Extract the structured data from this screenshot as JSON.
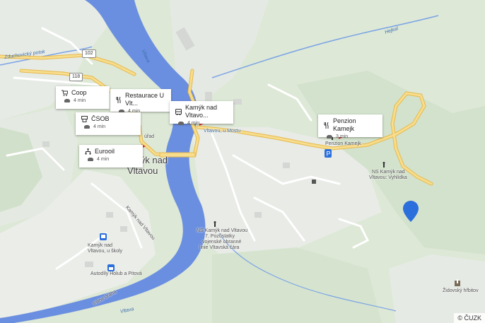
{
  "map": {
    "town_name_line1": "Kamýk nad",
    "town_name_line2": "Vltavou",
    "road_numbers": [
      "102",
      "118"
    ],
    "water_labels": {
      "stream": "Zduchovický potok",
      "river_north": "Vltava",
      "river_south": "Vltava",
      "hejkal": "Hejkal"
    },
    "street_labels": {
      "kamyk_street": "Kamýk nad Vltavou",
      "kamyk_skoly": "Kamýk nad Vltavou, u školy",
      "kamyk_skoly_line1": "Kamýk nad",
      "kamyk_skoly_line2": "Vltavou, u školy",
      "autodily_line1": "Autodíly Holub a Pitová",
      "inline_draha": "Inline dráha",
      "vltavou_u_mostu": "Vltavou, u Mostu",
      "ns_kamyk_line1": "NS Kamýk nad Vltavou",
      "ns_kamyk_line2": "7. Pozůstatky",
      "ns_kamyk_line3": "vojenské obranné",
      "ns_kamyk_line4": "linie Vltavská čára",
      "ns_vyhlidka_line1": "NS Kamýk nad",
      "ns_vyhlidka_line2": "Vltavou: Vyhlídka",
      "penzion_small": "Penzion Kamejk",
      "zidovsky": "Židovský hřbitov",
      "urad": "úřad"
    },
    "copyright": "© ČUZK"
  },
  "poi_cards": [
    {
      "name": "Coop",
      "icon": "cart-icon",
      "time": "4 min"
    },
    {
      "name": "Restaurace U Vlt...",
      "icon": "restaurant-icon",
      "time": "4 min"
    },
    {
      "name": "ČSOB",
      "icon": "atm-icon",
      "time": "4 min"
    },
    {
      "name": "Kamýk nad Vltavo...",
      "icon": "bus-icon",
      "time": "4 min"
    },
    {
      "name": "Eurooil",
      "icon": "fuel-network-icon",
      "time": "4 min"
    },
    {
      "name": "Penzion Kamejk",
      "icon": "restaurant-icon",
      "time": "3 min"
    }
  ],
  "colors": {
    "river": "#6b8fe0",
    "road_main": "#f2cd6b",
    "marker": "#2b6fdc",
    "forest": "#dde8d6",
    "urban": "#e9ece8"
  }
}
